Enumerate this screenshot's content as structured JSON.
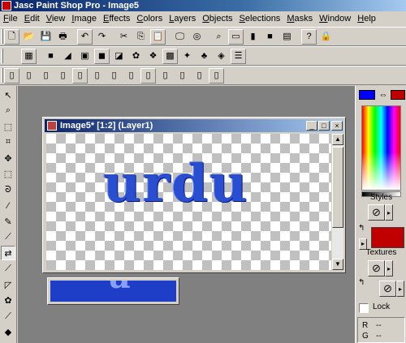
{
  "app": {
    "title": "Jasc Paint Shop Pro - Image5"
  },
  "menu": [
    "File",
    "Edit",
    "View",
    "Image",
    "Effects",
    "Colors",
    "Layers",
    "Objects",
    "Selections",
    "Masks",
    "Window",
    "Help"
  ],
  "toolbar1": [
    {
      "name": "new-icon",
      "glyph": "🗋"
    },
    {
      "name": "open-icon",
      "glyph": "📂"
    },
    {
      "name": "save-icon",
      "glyph": "💾"
    },
    {
      "name": "print-icon",
      "glyph": "🖶"
    },
    {
      "name": "undo-icon",
      "glyph": "↶"
    },
    {
      "name": "redo-icon",
      "glyph": "↷"
    },
    {
      "name": "cut-icon",
      "glyph": "✂"
    },
    {
      "name": "copy-icon",
      "glyph": "⎘"
    },
    {
      "name": "paste-icon",
      "glyph": "📋"
    },
    {
      "name": "screen-capture-icon",
      "glyph": "🖵"
    },
    {
      "name": "browse-icon",
      "glyph": "◎"
    },
    {
      "name": "zoom-icon",
      "glyph": "⌕"
    },
    {
      "name": "tool-options-icon",
      "glyph": "▭"
    },
    {
      "name": "histogram-icon",
      "glyph": "▮"
    },
    {
      "name": "color-palette-icon",
      "glyph": "■"
    },
    {
      "name": "layer-palette-icon",
      "glyph": "▤"
    },
    {
      "name": "help-context-icon",
      "glyph": "?"
    },
    {
      "name": "lock-icon",
      "glyph": "🔒"
    }
  ],
  "toolbar2": [
    {
      "name": "effect-1-icon",
      "glyph": "▦"
    },
    {
      "name": "effect-2-icon",
      "glyph": "■"
    },
    {
      "name": "effect-3-icon",
      "glyph": "◢"
    },
    {
      "name": "effect-4-icon",
      "glyph": "▣"
    },
    {
      "name": "effect-5-icon",
      "glyph": "◼"
    },
    {
      "name": "effect-6-icon",
      "glyph": "◪"
    },
    {
      "name": "effect-7-icon",
      "glyph": "✿"
    },
    {
      "name": "effect-8-icon",
      "glyph": "❖"
    },
    {
      "name": "effect-9-icon",
      "glyph": "▩"
    },
    {
      "name": "effect-10-icon",
      "glyph": "✦"
    },
    {
      "name": "effect-11-icon",
      "glyph": "♣"
    },
    {
      "name": "effect-12-icon",
      "glyph": "◈"
    },
    {
      "name": "effect-13-icon",
      "glyph": "☰"
    }
  ],
  "toolbar3": [
    {
      "name": "layer-1-icon",
      "glyph": "▯"
    },
    {
      "name": "layer-2-icon",
      "glyph": "▯"
    },
    {
      "name": "layer-3-icon",
      "glyph": "▯"
    },
    {
      "name": "layer-4-icon",
      "glyph": "▯"
    },
    {
      "name": "layer-5-icon",
      "glyph": "▯"
    },
    {
      "name": "layer-6-icon",
      "glyph": "▯"
    },
    {
      "name": "layer-7-icon",
      "glyph": "▯"
    },
    {
      "name": "layer-8-icon",
      "glyph": "▯"
    },
    {
      "name": "layer-9-icon",
      "glyph": "▯"
    },
    {
      "name": "layer-10-icon",
      "glyph": "▯"
    },
    {
      "name": "layer-11-icon",
      "glyph": "▯"
    },
    {
      "name": "layer-12-icon",
      "glyph": "▯"
    },
    {
      "name": "layer-13-icon",
      "glyph": "▯"
    }
  ],
  "tools": [
    {
      "name": "arrow-tool-icon",
      "glyph": "↖"
    },
    {
      "name": "zoom-tool-icon",
      "glyph": "⌕"
    },
    {
      "name": "deform-tool-icon",
      "glyph": "⬚"
    },
    {
      "name": "crop-tool-icon",
      "glyph": "⌗"
    },
    {
      "name": "mover-tool-icon",
      "glyph": "✥"
    },
    {
      "name": "selection-tool-icon",
      "glyph": "⬚"
    },
    {
      "name": "lasso-tool-icon",
      "glyph": "ᘐ"
    },
    {
      "name": "dropper-tool-icon",
      "glyph": "⁄"
    },
    {
      "name": "paint-brush-tool-icon",
      "glyph": "✎"
    },
    {
      "name": "clone-tool-icon",
      "glyph": "⟋"
    },
    {
      "name": "color-replacer-tool-icon",
      "glyph": "⇄"
    },
    {
      "name": "retouch-tool-icon",
      "glyph": "⟋"
    },
    {
      "name": "eraser-tool-icon",
      "glyph": "◸"
    },
    {
      "name": "picture-tube-tool-icon",
      "glyph": "✿"
    },
    {
      "name": "airbrush-tool-icon",
      "glyph": "⟋"
    },
    {
      "name": "flood-fill-tool-icon",
      "glyph": "◆"
    }
  ],
  "image_window": {
    "title": "Image5* [1:2] (Layer1)",
    "art_text": "urdu"
  },
  "behind_window": {
    "art_text": "u"
  },
  "palette": {
    "fg_color": "#0000ff",
    "bg_color": "#c00000",
    "styles_label": "Styles",
    "textures_label": "Textures",
    "lock_label": "Lock",
    "r_label": "R",
    "r_value": "--",
    "g_label": "G",
    "g_value": "--"
  }
}
